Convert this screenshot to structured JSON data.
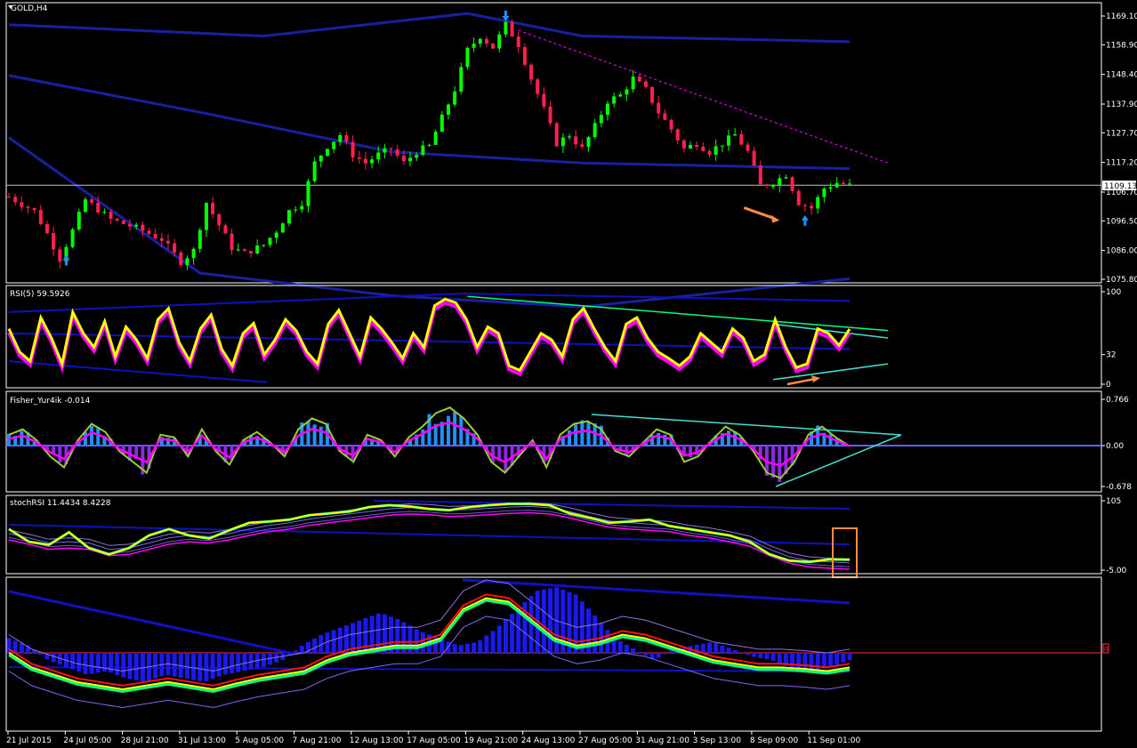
{
  "chart_header": {
    "symbol_label": "GOLD,H4"
  },
  "current_price_label": "1109.13",
  "colors": {
    "background": "#000000",
    "frame": "#ffffff",
    "bull": "#00ff00",
    "bear": "#ff2050",
    "bb": "#1820a0",
    "rsi_line": "#ffff00",
    "rsi_shadow": "#ff00ff",
    "fisher_hist_up": "#1e90ff",
    "fisher_hist_down": "#8a2be2",
    "fisher_line": "#ff00ff",
    "fisher_signal": "#9acd32",
    "trend_cyan": "#40e0d0",
    "arrow_orange": "#ff8c40",
    "marker_blue": "#1e90ff"
  },
  "chart_data": [
    {
      "name": "main",
      "type": "candlestick",
      "title": "GOLD,H4",
      "ylim": [
        1075.8,
        1169.1
      ],
      "y_ticks": [
        "1169.10",
        "1158.90",
        "1148.40",
        "1137.90",
        "1127.70",
        "1117.20",
        "1106.70",
        "1096.50",
        "1086.00",
        "1075.80"
      ],
      "current_price": 1109.13,
      "x_tick_labels": [
        "21 Jul 2015",
        "24 Jul 05:00",
        "28 Jul 21:00",
        "31 Jul 13:00",
        "5 Aug 05:00",
        "7 Aug 21:00",
        "12 Aug 13:00",
        "17 Aug 05:00",
        "19 Aug 21:00",
        "24 Aug 13:00",
        "27 Aug 05:00",
        "31 Aug 21:00",
        "3 Sep 13:00",
        "8 Sep 09:00",
        "11 Sep 01:00"
      ],
      "price_path": [
        [
          0,
          1105
        ],
        [
          4,
          1100
        ],
        [
          6,
          1092
        ],
        [
          8,
          1083
        ],
        [
          10,
          1093
        ],
        [
          12,
          1104
        ],
        [
          16,
          1097
        ],
        [
          20,
          1094
        ],
        [
          24,
          1090
        ],
        [
          27,
          1082
        ],
        [
          29,
          1086
        ],
        [
          31,
          1103
        ],
        [
          33,
          1095
        ],
        [
          35,
          1087
        ],
        [
          37,
          1085
        ],
        [
          40,
          1088
        ],
        [
          42,
          1093
        ],
        [
          44,
          1100
        ],
        [
          46,
          1103
        ],
        [
          48,
          1117
        ],
        [
          50,
          1123
        ],
        [
          52,
          1127
        ],
        [
          54,
          1120
        ],
        [
          56,
          1117
        ],
        [
          58,
          1120
        ],
        [
          60,
          1122
        ],
        [
          62,
          1117
        ],
        [
          64,
          1121
        ],
        [
          66,
          1123
        ],
        [
          68,
          1133
        ],
        [
          70,
          1143
        ],
        [
          72,
          1157
        ],
        [
          74,
          1162
        ],
        [
          76,
          1158
        ],
        [
          78,
          1166
        ],
        [
          80,
          1159
        ],
        [
          82,
          1147
        ],
        [
          84,
          1136
        ],
        [
          86,
          1124
        ],
        [
          88,
          1127
        ],
        [
          90,
          1122
        ],
        [
          92,
          1130
        ],
        [
          94,
          1139
        ],
        [
          96,
          1141
        ],
        [
          98,
          1147
        ],
        [
          100,
          1143
        ],
        [
          102,
          1135
        ],
        [
          104,
          1129
        ],
        [
          106,
          1122
        ],
        [
          108,
          1124
        ],
        [
          110,
          1121
        ],
        [
          112,
          1124
        ],
        [
          114,
          1127
        ],
        [
          116,
          1121
        ],
        [
          118,
          1109
        ],
        [
          120,
          1110
        ],
        [
          122,
          1113
        ],
        [
          124,
          1103
        ],
        [
          126,
          1101
        ],
        [
          128,
          1108
        ],
        [
          130,
          1110
        ],
        [
          132,
          1109
        ]
      ],
      "bollinger_mid": [
        [
          0,
          1148
        ],
        [
          30,
          1135
        ],
        [
          60,
          1121
        ],
        [
          90,
          1117
        ],
        [
          132,
          1115
        ]
      ],
      "bollinger_upper": [
        [
          0,
          1166
        ],
        [
          40,
          1162
        ],
        [
          72,
          1170
        ],
        [
          90,
          1162
        ],
        [
          132,
          1160
        ]
      ],
      "bollinger_lower": [
        [
          0,
          1126
        ],
        [
          30,
          1078
        ],
        [
          60,
          1070
        ],
        [
          90,
          1066
        ],
        [
          132,
          1076
        ]
      ],
      "resistance_line": [
        [
          80,
          1164
        ],
        [
          138,
          1117
        ]
      ],
      "up_markers_at": [
        9,
        125
      ],
      "down_markers_at": [
        78
      ]
    },
    {
      "name": "rsi",
      "type": "line",
      "title": "RSI(5) 59.5926",
      "ylim": [
        0,
        100
      ],
      "y_ticks": [
        "100",
        "32",
        "0"
      ],
      "line_value_last": 59.5926,
      "values": [
        60,
        35,
        25,
        72,
        50,
        22,
        78,
        55,
        40,
        68,
        30,
        62,
        48,
        28,
        70,
        82,
        45,
        25,
        60,
        75,
        38,
        20,
        55,
        66,
        32,
        48,
        70,
        58,
        35,
        22,
        65,
        80,
        55,
        30,
        72,
        60,
        45,
        28,
        55,
        40,
        85,
        92,
        88,
        70,
        40,
        62,
        55,
        20,
        15,
        35,
        55,
        48,
        30,
        70,
        82,
        60,
        40,
        25,
        65,
        72,
        50,
        35,
        28,
        20,
        30,
        55,
        45,
        35,
        60,
        50,
        25,
        32,
        70,
        40,
        18,
        22,
        60,
        55,
        42,
        59.59
      ],
      "trend_lines": [
        {
          "color": "#00ff80",
          "from": [
            72,
            95
          ],
          "to": [
            138,
            58
          ]
        },
        {
          "color": "#40e0d0",
          "from": [
            120,
            65
          ],
          "to": [
            138,
            50
          ]
        },
        {
          "color": "#40e0d0",
          "from": [
            120,
            5
          ],
          "to": [
            138,
            22
          ]
        }
      ]
    },
    {
      "name": "fisher",
      "type": "bar",
      "title": "Fisher_Yur4ik -0.014",
      "ylim": [
        -0.678,
        0.766
      ],
      "y_ticks": [
        "0.766",
        "0.00",
        "-0.678"
      ],
      "line_value_last": -0.014,
      "values": [
        0.2,
        0.3,
        0.1,
        -0.2,
        -0.4,
        0.1,
        0.4,
        0.25,
        -0.1,
        -0.3,
        -0.5,
        0.2,
        0.15,
        -0.2,
        0.3,
        -0.1,
        -0.35,
        0.1,
        0.25,
        0.05,
        -0.2,
        0.3,
        0.5,
        0.4,
        -0.1,
        -0.3,
        0.2,
        0.1,
        -0.2,
        0.15,
        0.35,
        0.6,
        0.7,
        0.5,
        0.2,
        -0.3,
        -0.5,
        -0.2,
        0.1,
        -0.4,
        0.2,
        0.4,
        0.45,
        0.3,
        -0.1,
        -0.2,
        0.05,
        0.3,
        0.2,
        -0.3,
        -0.2,
        0.1,
        0.35,
        0.2,
        -0.1,
        -0.5,
        -0.6,
        -0.3,
        0.2,
        0.35,
        0.15,
        -0.01
      ]
    },
    {
      "name": "stochrsi",
      "type": "line",
      "title": "stochRSI 11.4434 8.4228",
      "ylim": [
        -5,
        105
      ],
      "y_ticks": [
        "105",
        "-5.00"
      ],
      "k_values": [
        60,
        40,
        35,
        55,
        30,
        20,
        30,
        50,
        60,
        50,
        45,
        58,
        70,
        72,
        75,
        82,
        85,
        88,
        95,
        98,
        96,
        92,
        90,
        95,
        98,
        100,
        100,
        98,
        85,
        78,
        70,
        72,
        75,
        65,
        60,
        55,
        50,
        40,
        20,
        10,
        8,
        12,
        11.44
      ],
      "d_values": [
        55,
        48,
        40,
        42,
        40,
        30,
        32,
        40,
        48,
        52,
        50,
        55,
        62,
        68,
        72,
        78,
        82,
        86,
        90,
        94,
        96,
        95,
        92,
        93,
        95,
        97,
        98,
        96,
        90,
        82,
        75,
        72,
        70,
        68,
        62,
        58,
        52,
        45,
        30,
        18,
        12,
        10,
        8.42
      ],
      "highlight_box": "last bars"
    },
    {
      "name": "oscillator",
      "type": "area",
      "ylim": [
        -1,
        1
      ],
      "zero_label": "0",
      "values": [
        0.2,
        0.1,
        -0.1,
        -0.2,
        -0.3,
        -0.25,
        -0.35,
        -0.4,
        -0.3,
        -0.35,
        -0.4,
        -0.3,
        -0.25,
        -0.2,
        -0.1,
        0.1,
        0.25,
        0.35,
        0.45,
        0.55,
        0.45,
        0.3,
        0.2,
        0.1,
        0.15,
        0.35,
        0.6,
        0.85,
        0.9,
        0.8,
        0.5,
        0.2,
        0.05,
        -0.1,
        0.05,
        0.1,
        0.15,
        0.05,
        -0.05,
        -0.1,
        -0.2,
        -0.25,
        -0.2,
        -0.1
      ],
      "line_values": [
        0.0,
        -0.2,
        -0.3,
        -0.4,
        -0.45,
        -0.5,
        -0.45,
        -0.4,
        -0.45,
        -0.5,
        -0.42,
        -0.35,
        -0.3,
        -0.25,
        -0.1,
        0.0,
        0.05,
        0.1,
        0.1,
        0.2,
        0.6,
        0.75,
        0.7,
        0.45,
        0.2,
        0.1,
        0.15,
        0.25,
        0.2,
        0.1,
        0.0,
        -0.1,
        -0.15,
        -0.2,
        -0.2,
        -0.22,
        -0.25,
        -0.2
      ]
    }
  ]
}
